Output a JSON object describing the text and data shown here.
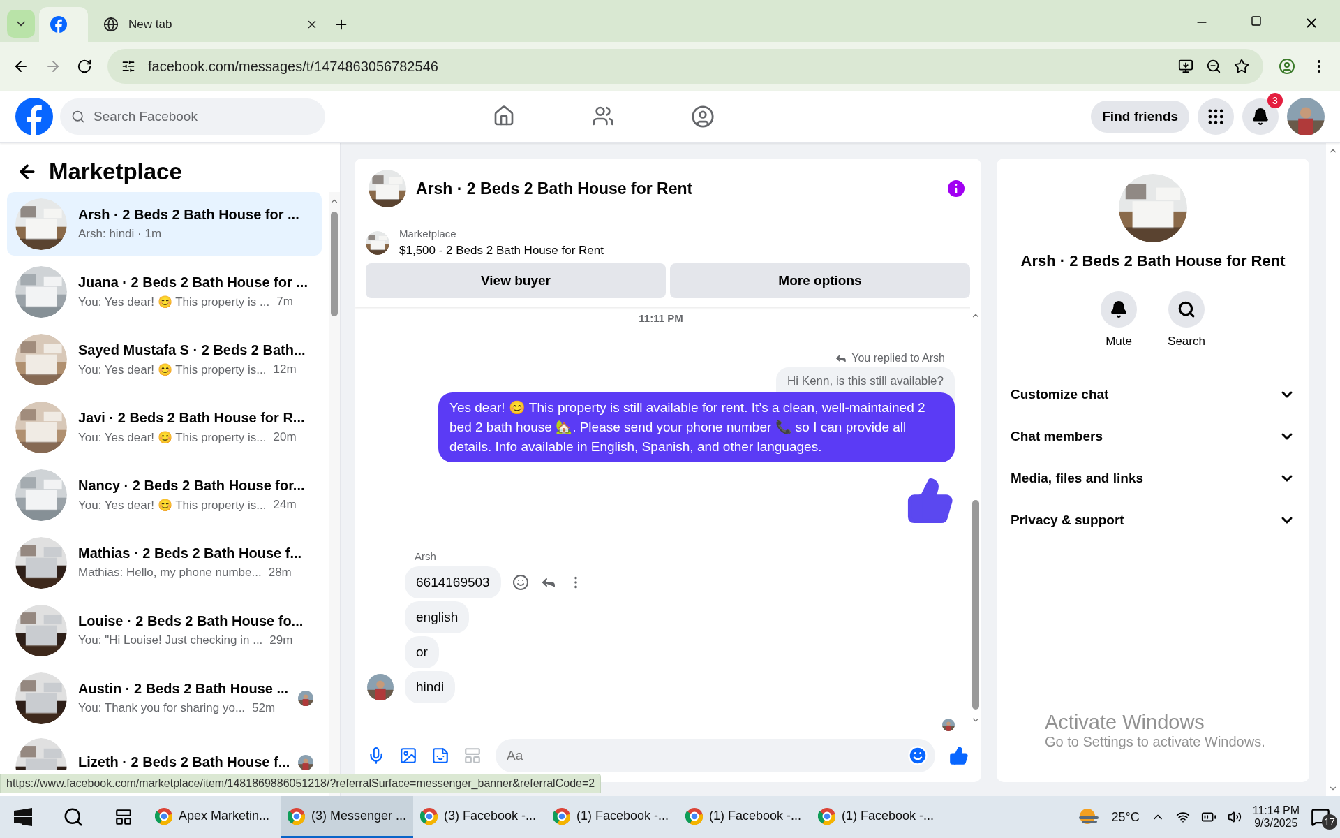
{
  "browser": {
    "tabs": [
      {
        "kind": "facebook",
        "selected": true
      },
      {
        "kind": "chrome",
        "label": "New tab",
        "selected": false
      }
    ],
    "url": "facebook.com/messages/t/1474863056782546"
  },
  "topbar": {
    "search_placeholder": "Search Facebook",
    "find_friends": "Find friends",
    "notification_count": "3"
  },
  "sidebar": {
    "title": "Marketplace",
    "conversations": [
      {
        "title": "Arsh · 2 Beds 2 Bath House for ...",
        "preview": "Arsh: hindi · 1m",
        "selected": true,
        "seen_avatar": false
      },
      {
        "title": "Juana · 2 Beds 2 Bath House for ...",
        "preview": "You: Yes dear! 😊 This property is ...",
        "time": "7m",
        "selected": false,
        "seen_avatar": false
      },
      {
        "title": "Sayed Mustafa S · 2 Beds 2 Bath...",
        "preview": "You: Yes dear! 😊 This property is...",
        "time": "12m",
        "selected": false,
        "seen_avatar": false
      },
      {
        "title": "Javi · 2 Beds 2 Bath House for R...",
        "preview": "You: Yes dear! 😊 This property is...",
        "time": "20m",
        "selected": false,
        "seen_avatar": false
      },
      {
        "title": "Nancy · 2 Beds 2 Bath House for...",
        "preview": "You: Yes dear! 😊 This property is...",
        "time": "24m",
        "selected": false,
        "seen_avatar": false
      },
      {
        "title": "Mathias · 2 Beds 2 Bath House f...",
        "preview": "Mathias: Hello, my phone numbe...",
        "time": "28m",
        "selected": false,
        "seen_avatar": false
      },
      {
        "title": "Louise · 2 Beds 2 Bath House fo...",
        "preview": "You: \"Hi Louise! Just checking in ...",
        "time": "29m",
        "selected": false,
        "seen_avatar": false
      },
      {
        "title": "Austin · 2 Beds 2 Bath House ...",
        "preview": "You: Thank you for sharing yo...",
        "time": "52m",
        "selected": false,
        "seen_avatar": true
      },
      {
        "title": "Lizeth · 2 Beds 2 Bath House f...",
        "selected": false,
        "seen_avatar": true
      }
    ]
  },
  "chat": {
    "title": "Arsh · 2 Beds 2 Bath House for Rent",
    "listing": {
      "label": "Marketplace",
      "title": "$1,500 - 2 Beds 2 Bath House for Rent"
    },
    "buttons": [
      "View buyer",
      "More options"
    ],
    "messages": [
      {
        "kind": "timestamp",
        "text": "11:11 PM"
      },
      {
        "kind": "reply_note",
        "text": "You replied to Arsh"
      },
      {
        "kind": "quoted",
        "text": "Hi Kenn, is this still available?"
      },
      {
        "kind": "outgoing",
        "text": "Yes dear! 😊 This property is still available for rent. It’s a clean, well-maintained 2 bed 2 bath house 🏡. Please send your phone number 📞 so I can provide all details. Info available in English, Spanish, and other languages."
      },
      {
        "kind": "like"
      },
      {
        "kind": "sender",
        "text": "Arsh"
      },
      {
        "kind": "incoming",
        "text": "6614169503",
        "actions": true,
        "avatar": false
      },
      {
        "kind": "incoming",
        "text": "english",
        "actions": false,
        "avatar": false
      },
      {
        "kind": "incoming",
        "text": "or",
        "actions": false,
        "avatar": false
      },
      {
        "kind": "incoming",
        "text": "hindi",
        "actions": false,
        "avatar": true
      },
      {
        "kind": "seen"
      }
    ],
    "composer_placeholder": "Aa"
  },
  "info": {
    "title": "Arsh · 2 Beds 2 Bath House for Rent",
    "actions": [
      {
        "kind": "mute",
        "label": "Mute"
      },
      {
        "kind": "search",
        "label": "Search"
      }
    ],
    "sections": [
      {
        "label": "Customize chat",
        "expanded": false
      },
      {
        "label": "Chat members",
        "expanded": false
      },
      {
        "label": "Media, files and links",
        "expanded": false
      },
      {
        "label": "Privacy & support",
        "expanded": false
      }
    ]
  },
  "status_url": "https://www.facebook.com/marketplace/item/1481869886051218/?referralSurface=messenger_banner&referralCode=2",
  "activation": {
    "title": "Activate Windows",
    "text": "Go to Settings to activate Windows."
  },
  "taskbar": {
    "apps": [
      {
        "label": "Apex Marketin...",
        "selected": false
      },
      {
        "label": "(3) Messenger ...",
        "selected": true
      },
      {
        "label": "(3) Facebook -...",
        "selected": false
      },
      {
        "label": "(1) Facebook -...",
        "selected": false
      },
      {
        "label": "(1) Facebook -...",
        "selected": false
      },
      {
        "label": "(1) Facebook -...",
        "selected": false
      }
    ],
    "temperature": "25°C",
    "time": "11:14 PM",
    "date": "9/3/2025",
    "notifications": "17"
  }
}
